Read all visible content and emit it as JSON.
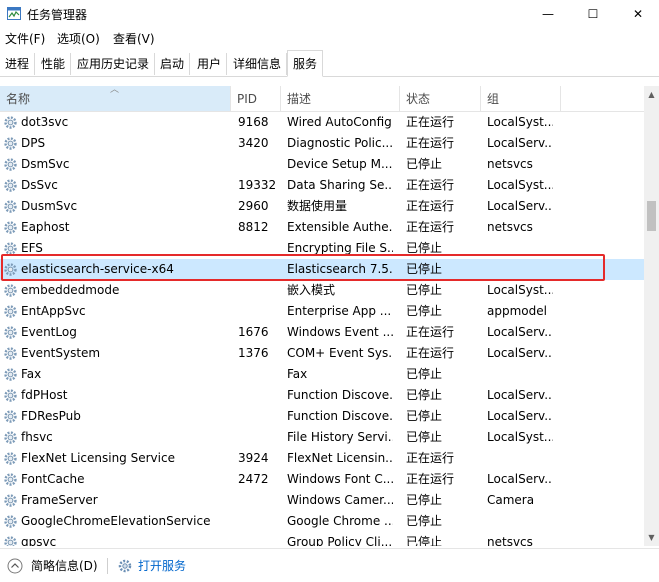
{
  "window": {
    "title": "任务管理器",
    "min_glyph": "—",
    "max_glyph": "☐",
    "close_glyph": "✕"
  },
  "menu": [
    "文件(F)",
    "选项(O)",
    "查看(V)"
  ],
  "tabs": [
    "进程",
    "性能",
    "应用历史记录",
    "启动",
    "用户",
    "详细信息",
    "服务"
  ],
  "active_tab": "服务",
  "columns": {
    "name": "名称",
    "pid": "PID",
    "desc": "描述",
    "status": "状态",
    "group": "组"
  },
  "services": [
    {
      "name": "dot3svc",
      "pid": "9168",
      "desc": "Wired AutoConfig",
      "status": "正在运行",
      "group": "LocalSyst..."
    },
    {
      "name": "DPS",
      "pid": "3420",
      "desc": "Diagnostic Polic...",
      "status": "正在运行",
      "group": "LocalServ..."
    },
    {
      "name": "DsmSvc",
      "pid": "",
      "desc": "Device Setup M...",
      "status": "已停止",
      "group": "netsvcs"
    },
    {
      "name": "DsSvc",
      "pid": "19332",
      "desc": "Data Sharing Se...",
      "status": "正在运行",
      "group": "LocalSyst..."
    },
    {
      "name": "DusmSvc",
      "pid": "2960",
      "desc": "数据使用量",
      "status": "正在运行",
      "group": "LocalServ..."
    },
    {
      "name": "Eaphost",
      "pid": "8812",
      "desc": "Extensible Authe...",
      "status": "正在运行",
      "group": "netsvcs"
    },
    {
      "name": "EFS",
      "pid": "",
      "desc": "Encrypting File S...",
      "status": "已停止",
      "group": ""
    },
    {
      "name": "elasticsearch-service-x64",
      "pid": "",
      "desc": "Elasticsearch 7.5...",
      "status": "已停止",
      "group": ""
    },
    {
      "name": "embeddedmode",
      "pid": "",
      "desc": "嵌入模式",
      "status": "已停止",
      "group": "LocalSyst..."
    },
    {
      "name": "EntAppSvc",
      "pid": "",
      "desc": "Enterprise App ...",
      "status": "已停止",
      "group": "appmodel"
    },
    {
      "name": "EventLog",
      "pid": "1676",
      "desc": "Windows Event ...",
      "status": "正在运行",
      "group": "LocalServ..."
    },
    {
      "name": "EventSystem",
      "pid": "1376",
      "desc": "COM+ Event Sys...",
      "status": "正在运行",
      "group": "LocalServ..."
    },
    {
      "name": "Fax",
      "pid": "",
      "desc": "Fax",
      "status": "已停止",
      "group": ""
    },
    {
      "name": "fdPHost",
      "pid": "",
      "desc": "Function Discove...",
      "status": "已停止",
      "group": "LocalServ..."
    },
    {
      "name": "FDResPub",
      "pid": "",
      "desc": "Function Discove...",
      "status": "已停止",
      "group": "LocalServ..."
    },
    {
      "name": "fhsvc",
      "pid": "",
      "desc": "File History Servi...",
      "status": "已停止",
      "group": "LocalSyst..."
    },
    {
      "name": "FlexNet Licensing Service",
      "pid": "3924",
      "desc": "FlexNet Licensin...",
      "status": "正在运行",
      "group": ""
    },
    {
      "name": "FontCache",
      "pid": "2472",
      "desc": "Windows Font C...",
      "status": "正在运行",
      "group": "LocalServ..."
    },
    {
      "name": "FrameServer",
      "pid": "",
      "desc": "Windows Camer...",
      "status": "已停止",
      "group": "Camera"
    },
    {
      "name": "GoogleChromeElevationService",
      "pid": "",
      "desc": "Google Chrome ...",
      "status": "已停止",
      "group": ""
    },
    {
      "name": "gpsvc",
      "pid": "",
      "desc": "Group Policy Cli...",
      "status": "已停止",
      "group": "netsvcs"
    }
  ],
  "selected_index": 7,
  "footer": {
    "fewer_details": "简略信息(D)",
    "open_services": "打开服务"
  },
  "colors": {
    "selection": "#cce8ff",
    "highlight_border": "#e52a2a",
    "link": "#0066cc"
  }
}
